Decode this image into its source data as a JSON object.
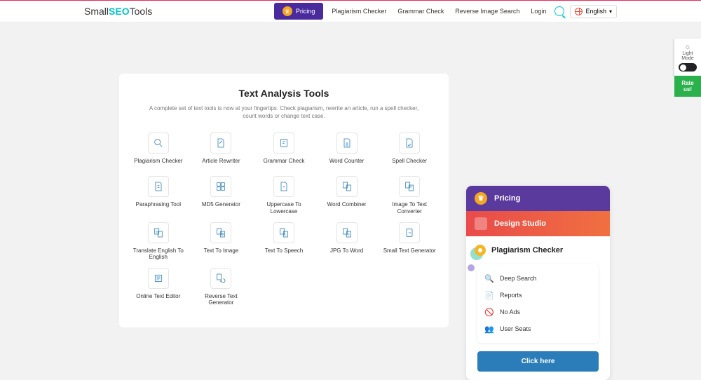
{
  "header": {
    "logo_pre": "Small",
    "logo_seo": "SEO",
    "logo_post": "Tools",
    "pricing_label": "Pricing",
    "nav": [
      "Plagiarism Checker",
      "Grammar Check",
      "Reverse Image Search",
      "Login"
    ],
    "lang": "English"
  },
  "section": {
    "title": "Text Analysis Tools",
    "desc": "A complete set of text tools is now at your fingertips. Check plagiarism, rewrite an article, run a spell checker, count words or change text case."
  },
  "tools": [
    "Plagiarism Checker",
    "Article Rewriter",
    "Grammar Check",
    "Word Counter",
    "Spell Checker",
    "Paraphrasing Tool",
    "MD5 Generator",
    "Uppercase To Lowercase",
    "Word Combiner",
    "Image To Text Converter",
    "Translate English To English",
    "Text To Image",
    "Text To Speech",
    "JPG To Word",
    "Small Text Generator",
    "Online Text Editor",
    "Reverse Text Generator"
  ],
  "sidecard": {
    "pricing": "Pricing",
    "design": "Design Studio",
    "title": "Plagiarism Checker",
    "features": [
      "Deep Search",
      "Reports",
      "No Ads",
      "User Seats"
    ],
    "cta": "Click here"
  },
  "widgets": {
    "light": "Light",
    "mode": "Mode",
    "rate": "Rate us!"
  }
}
